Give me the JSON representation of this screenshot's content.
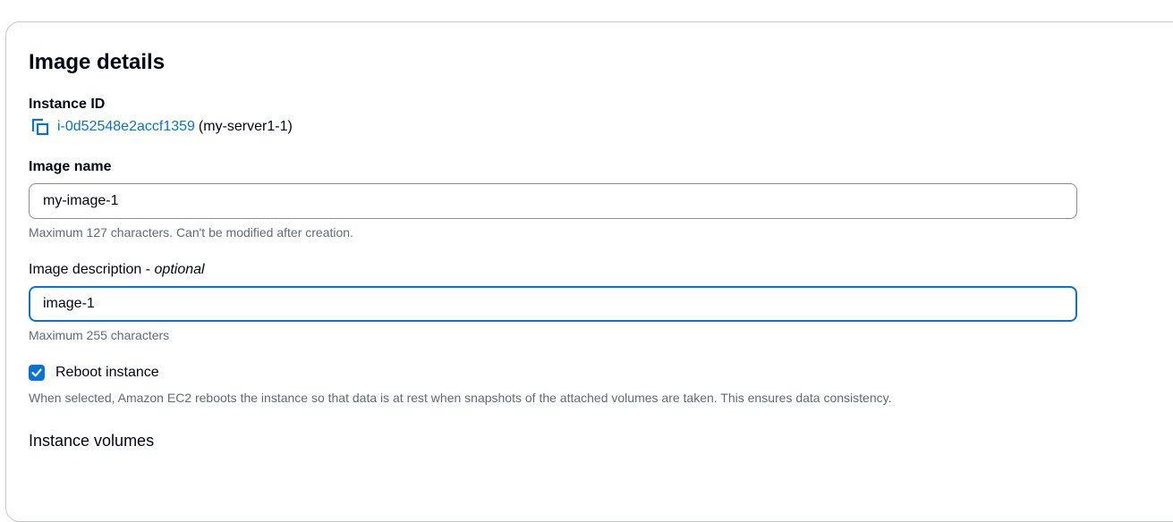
{
  "card": {
    "title": "Image details"
  },
  "instance": {
    "label": "Instance ID",
    "id": "i-0d52548e2accf1359",
    "name_suffix": "(my-server1-1)",
    "icon": "copy-icon"
  },
  "image_name": {
    "label": "Image name",
    "value": "my-image-1",
    "hint": "Maximum 127 characters. Can't be modified after creation."
  },
  "image_description": {
    "label": "Image description",
    "optional": "optional",
    "separator": " - ",
    "value": "image-1",
    "hint": "Maximum 255 characters"
  },
  "reboot": {
    "label": "Reboot instance",
    "checked": true,
    "hint": "When selected, Amazon EC2 reboots the instance so that data is at rest when snapshots of the attached volumes are taken. This ensures data consistency."
  },
  "volumes": {
    "title": "Instance volumes"
  },
  "colors": {
    "link": "#0972d3",
    "focus": "#0972d3",
    "text": "#000716",
    "hint": "#5f6b7a",
    "border": "#8c8c94"
  }
}
